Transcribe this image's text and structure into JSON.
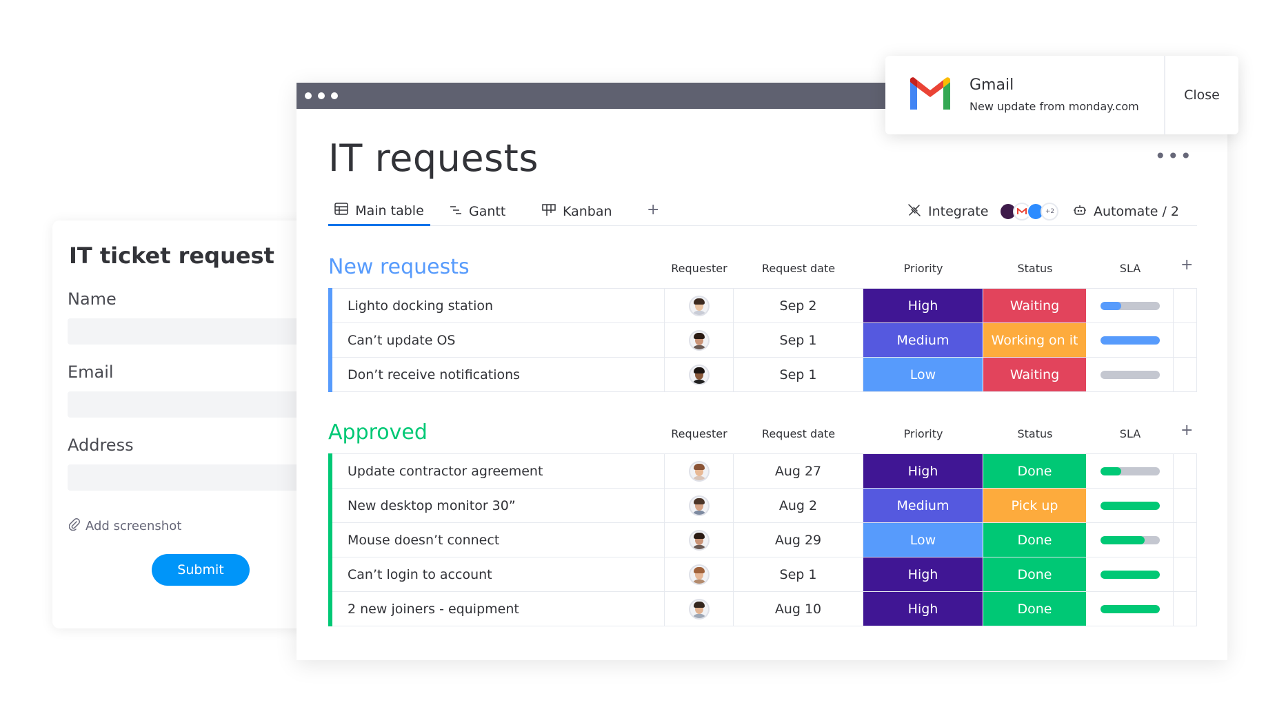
{
  "form": {
    "title": "IT ticket request",
    "fields": [
      {
        "label": "Name",
        "value": ""
      },
      {
        "label": "Email",
        "value": ""
      },
      {
        "label": "Address",
        "value": ""
      }
    ],
    "add_screenshot": "Add screenshot",
    "submit": "Submit"
  },
  "board": {
    "title": "IT requests",
    "tabs": [
      "Main table",
      "Gantt",
      "Kanban"
    ],
    "add_tab": "+",
    "integrate": "Integrate",
    "integrate_more": "+2",
    "automate": "Automate / 2",
    "more": "•••"
  },
  "columns": {
    "requester": "Requester",
    "date": "Request date",
    "priority": "Priority",
    "status": "Status",
    "sla": "SLA",
    "add": "+"
  },
  "groups": [
    {
      "title": "New requests",
      "color": "#579bfc",
      "rows": [
        {
          "name": "Lighto docking station",
          "date": "Sep 2",
          "priority": "High",
          "status": "Waiting",
          "sla": 0.35
        },
        {
          "name": "Can’t update OS",
          "date": "Sep 1",
          "priority": "Medium",
          "status": "Working on it",
          "sla": 1.0
        },
        {
          "name": "Don’t receive notifications",
          "date": "Sep 1",
          "priority": "Low",
          "status": "Waiting",
          "sla": 0.0
        }
      ]
    },
    {
      "title": "Approved",
      "color": "#00c875",
      "rows": [
        {
          "name": "Update contractor agreement",
          "date": "Aug 27",
          "priority": "High",
          "status": "Done",
          "sla": 0.35
        },
        {
          "name": "New desktop monitor 30”",
          "date": "Aug 2",
          "priority": "Medium",
          "status": "Pick up",
          "sla": 1.0
        },
        {
          "name": "Mouse doesn’t connect",
          "date": "Aug 29",
          "priority": "Low",
          "status": "Done",
          "sla": 0.75
        },
        {
          "name": "Can’t login to account",
          "date": "Sep 1",
          "priority": "High",
          "status": "Done",
          "sla": 1.0
        },
        {
          "name": "2 new joiners - equipment",
          "date": "Aug 10",
          "priority": "High",
          "status": "Done",
          "sla": 1.0
        }
      ]
    }
  ],
  "colors": {
    "priority": {
      "High": "#401694",
      "Medium": "#5559df",
      "Low": "#579bfc"
    },
    "status": {
      "Waiting": "#e2445c",
      "Working on it": "#fdab3d",
      "Done": "#00c875",
      "Pick up": "#fdab3d"
    },
    "sla_new": "#579bfc",
    "sla_approved": "#00c875"
  },
  "toast": {
    "title": "Gmail",
    "subtitle": "New update from monday.com",
    "close": "Close"
  }
}
